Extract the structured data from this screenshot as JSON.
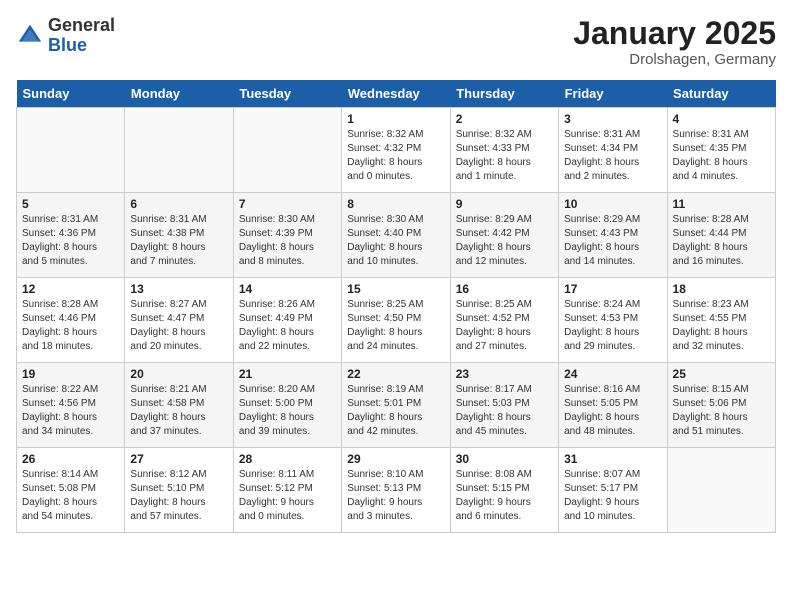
{
  "header": {
    "logo_general": "General",
    "logo_blue": "Blue",
    "title": "January 2025",
    "subtitle": "Drolshagen, Germany"
  },
  "days_of_week": [
    "Sunday",
    "Monday",
    "Tuesday",
    "Wednesday",
    "Thursday",
    "Friday",
    "Saturday"
  ],
  "weeks": [
    [
      {
        "day": "",
        "content": ""
      },
      {
        "day": "",
        "content": ""
      },
      {
        "day": "",
        "content": ""
      },
      {
        "day": "1",
        "content": "Sunrise: 8:32 AM\nSunset: 4:32 PM\nDaylight: 8 hours\nand 0 minutes."
      },
      {
        "day": "2",
        "content": "Sunrise: 8:32 AM\nSunset: 4:33 PM\nDaylight: 8 hours\nand 1 minute."
      },
      {
        "day": "3",
        "content": "Sunrise: 8:31 AM\nSunset: 4:34 PM\nDaylight: 8 hours\nand 2 minutes."
      },
      {
        "day": "4",
        "content": "Sunrise: 8:31 AM\nSunset: 4:35 PM\nDaylight: 8 hours\nand 4 minutes."
      }
    ],
    [
      {
        "day": "5",
        "content": "Sunrise: 8:31 AM\nSunset: 4:36 PM\nDaylight: 8 hours\nand 5 minutes."
      },
      {
        "day": "6",
        "content": "Sunrise: 8:31 AM\nSunset: 4:38 PM\nDaylight: 8 hours\nand 7 minutes."
      },
      {
        "day": "7",
        "content": "Sunrise: 8:30 AM\nSunset: 4:39 PM\nDaylight: 8 hours\nand 8 minutes."
      },
      {
        "day": "8",
        "content": "Sunrise: 8:30 AM\nSunset: 4:40 PM\nDaylight: 8 hours\nand 10 minutes."
      },
      {
        "day": "9",
        "content": "Sunrise: 8:29 AM\nSunset: 4:42 PM\nDaylight: 8 hours\nand 12 minutes."
      },
      {
        "day": "10",
        "content": "Sunrise: 8:29 AM\nSunset: 4:43 PM\nDaylight: 8 hours\nand 14 minutes."
      },
      {
        "day": "11",
        "content": "Sunrise: 8:28 AM\nSunset: 4:44 PM\nDaylight: 8 hours\nand 16 minutes."
      }
    ],
    [
      {
        "day": "12",
        "content": "Sunrise: 8:28 AM\nSunset: 4:46 PM\nDaylight: 8 hours\nand 18 minutes."
      },
      {
        "day": "13",
        "content": "Sunrise: 8:27 AM\nSunset: 4:47 PM\nDaylight: 8 hours\nand 20 minutes."
      },
      {
        "day": "14",
        "content": "Sunrise: 8:26 AM\nSunset: 4:49 PM\nDaylight: 8 hours\nand 22 minutes."
      },
      {
        "day": "15",
        "content": "Sunrise: 8:25 AM\nSunset: 4:50 PM\nDaylight: 8 hours\nand 24 minutes."
      },
      {
        "day": "16",
        "content": "Sunrise: 8:25 AM\nSunset: 4:52 PM\nDaylight: 8 hours\nand 27 minutes."
      },
      {
        "day": "17",
        "content": "Sunrise: 8:24 AM\nSunset: 4:53 PM\nDaylight: 8 hours\nand 29 minutes."
      },
      {
        "day": "18",
        "content": "Sunrise: 8:23 AM\nSunset: 4:55 PM\nDaylight: 8 hours\nand 32 minutes."
      }
    ],
    [
      {
        "day": "19",
        "content": "Sunrise: 8:22 AM\nSunset: 4:56 PM\nDaylight: 8 hours\nand 34 minutes."
      },
      {
        "day": "20",
        "content": "Sunrise: 8:21 AM\nSunset: 4:58 PM\nDaylight: 8 hours\nand 37 minutes."
      },
      {
        "day": "21",
        "content": "Sunrise: 8:20 AM\nSunset: 5:00 PM\nDaylight: 8 hours\nand 39 minutes."
      },
      {
        "day": "22",
        "content": "Sunrise: 8:19 AM\nSunset: 5:01 PM\nDaylight: 8 hours\nand 42 minutes."
      },
      {
        "day": "23",
        "content": "Sunrise: 8:17 AM\nSunset: 5:03 PM\nDaylight: 8 hours\nand 45 minutes."
      },
      {
        "day": "24",
        "content": "Sunrise: 8:16 AM\nSunset: 5:05 PM\nDaylight: 8 hours\nand 48 minutes."
      },
      {
        "day": "25",
        "content": "Sunrise: 8:15 AM\nSunset: 5:06 PM\nDaylight: 8 hours\nand 51 minutes."
      }
    ],
    [
      {
        "day": "26",
        "content": "Sunrise: 8:14 AM\nSunset: 5:08 PM\nDaylight: 8 hours\nand 54 minutes."
      },
      {
        "day": "27",
        "content": "Sunrise: 8:12 AM\nSunset: 5:10 PM\nDaylight: 8 hours\nand 57 minutes."
      },
      {
        "day": "28",
        "content": "Sunrise: 8:11 AM\nSunset: 5:12 PM\nDaylight: 9 hours\nand 0 minutes."
      },
      {
        "day": "29",
        "content": "Sunrise: 8:10 AM\nSunset: 5:13 PM\nDaylight: 9 hours\nand 3 minutes."
      },
      {
        "day": "30",
        "content": "Sunrise: 8:08 AM\nSunset: 5:15 PM\nDaylight: 9 hours\nand 6 minutes."
      },
      {
        "day": "31",
        "content": "Sunrise: 8:07 AM\nSunset: 5:17 PM\nDaylight: 9 hours\nand 10 minutes."
      },
      {
        "day": "",
        "content": ""
      }
    ]
  ]
}
